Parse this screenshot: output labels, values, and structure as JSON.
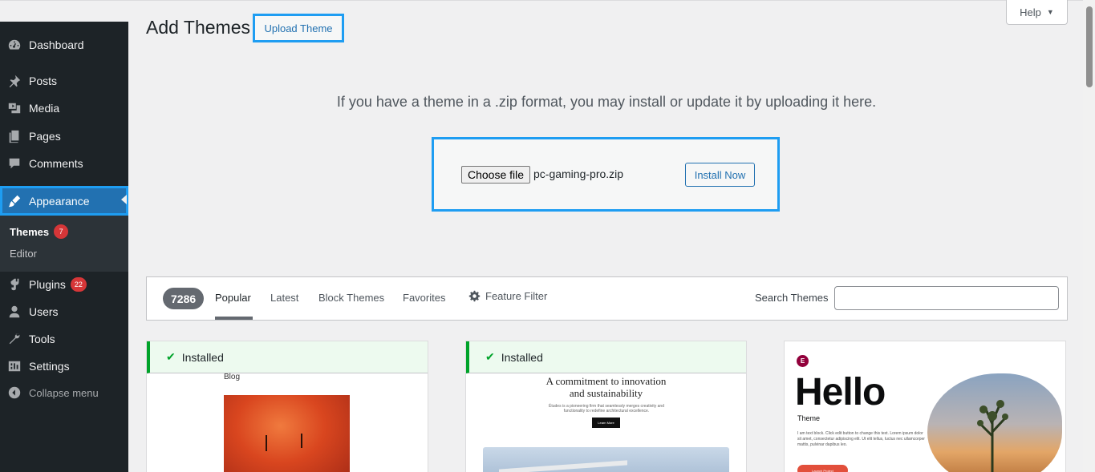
{
  "sidebar": {
    "items": [
      {
        "label": "Dashboard",
        "icon": "dashboard-icon"
      },
      {
        "label": "Posts",
        "icon": "pushpin-icon"
      },
      {
        "label": "Media",
        "icon": "media-icon"
      },
      {
        "label": "Pages",
        "icon": "pages-icon"
      },
      {
        "label": "Comments",
        "icon": "comment-icon"
      },
      {
        "label": "Appearance",
        "icon": "paintbrush-icon"
      }
    ],
    "submenu": {
      "themes_label": "Themes",
      "themes_badge": "7",
      "editor_label": "Editor"
    },
    "lower_items": [
      {
        "label": "Plugins",
        "icon": "plugin-icon",
        "badge": "22"
      },
      {
        "label": "Users",
        "icon": "user-icon"
      },
      {
        "label": "Tools",
        "icon": "wrench-icon"
      },
      {
        "label": "Settings",
        "icon": "settings-icon"
      }
    ],
    "collapse_label": "Collapse menu"
  },
  "header": {
    "title": "Add Themes",
    "upload_label": "Upload Theme",
    "help_label": "Help"
  },
  "upload": {
    "description": "If you have a theme in a .zip format, you may install or update it by uploading it here.",
    "choose_file_label": "Choose file",
    "file_name": "pc-gaming-pro.zip",
    "install_label": "Install Now"
  },
  "filter": {
    "count": "7286",
    "tabs": [
      "Popular",
      "Latest",
      "Block Themes",
      "Favorites"
    ],
    "feature_filter": "Feature Filter",
    "search_label": "Search Themes",
    "search_value": ""
  },
  "themes": [
    {
      "installed_label": "Installed",
      "preview_heading": "Blog"
    },
    {
      "installed_label": "Installed",
      "preview_heading": "A commitment to innovation and sustainability",
      "preview_body": "Études is a pioneering firm that seamlessly merges creativity and functionality to redefine architectural excellence.",
      "preview_button": "Learn More"
    },
    {
      "preview_logo": "E",
      "preview_heading": "Hello",
      "preview_sub": "Theme",
      "preview_body": "I am text block. Click edit button to change this text. Lorem ipsum dolor sit amet, consectetur adipiscing elit. Ut elit tellus, luctus nec ullamcorper mattis, pulvinar dapibus leo.",
      "preview_button": "Launch Project"
    }
  ],
  "colors": {
    "sidebar_bg": "#1d2327",
    "active_bg": "#2271b1",
    "highlight": "#1e9df2",
    "installed_green": "#00a32a",
    "badge_red": "#d63638"
  }
}
